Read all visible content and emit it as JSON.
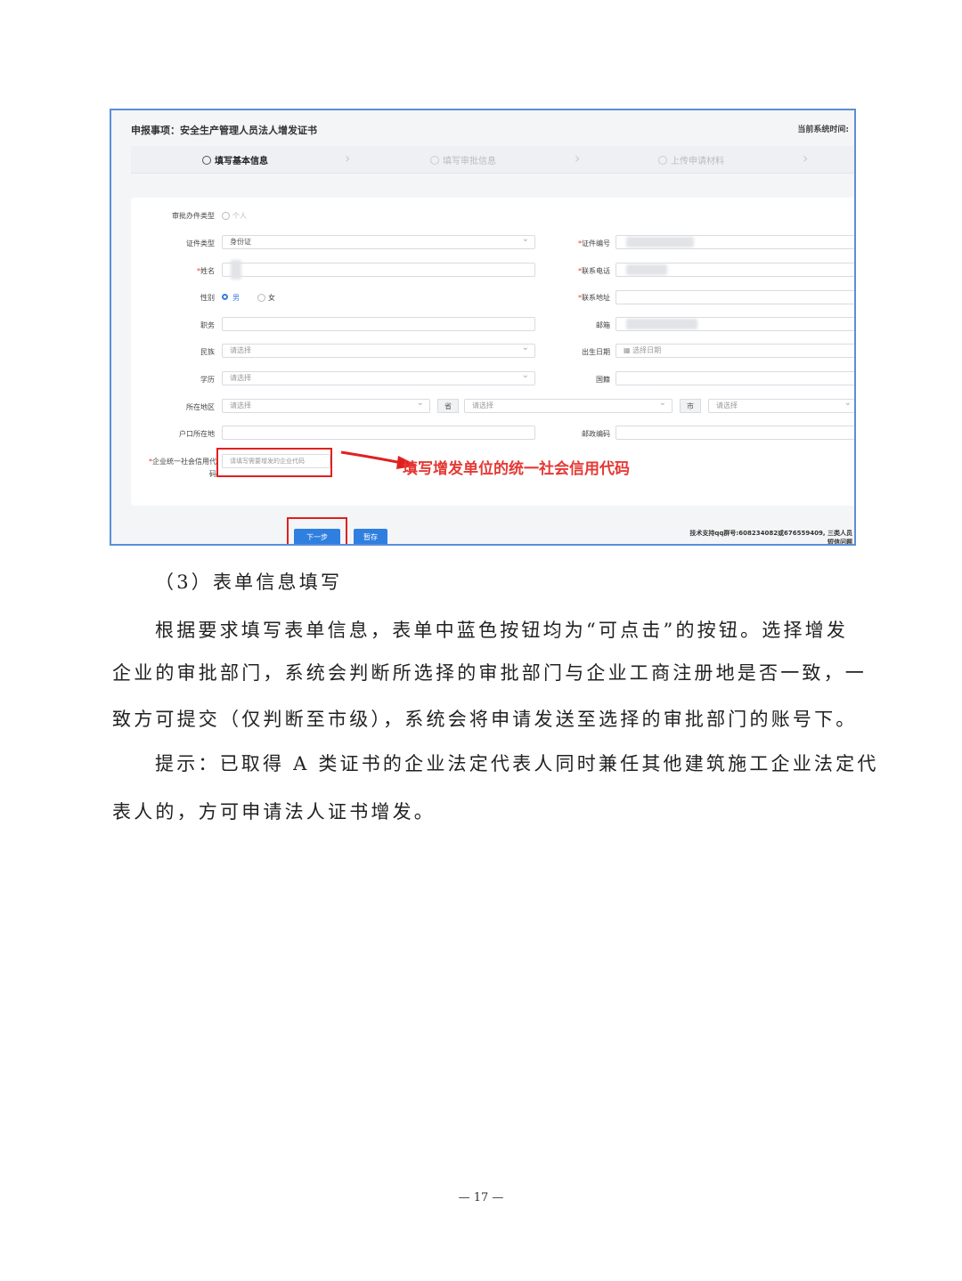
{
  "screenshot": {
    "title": "申报事项：安全生产管理人员法人增发证书",
    "system_time_label": "当前系统时间:",
    "steps": [
      {
        "label": "填写基本信息",
        "active": true
      },
      {
        "label": "填写审批信息",
        "active": false
      },
      {
        "label": "上传申请材料",
        "active": false
      }
    ],
    "form": {
      "approval_type_label": "审批办件类型",
      "approval_type_value": "个人",
      "id_type_label": "证件类型",
      "id_type_value": "身份证",
      "id_number_label": "证件编号",
      "name_label": "姓名",
      "phone_label": "联系电话",
      "gender_label": "性别",
      "gender_male": "男",
      "gender_female": "女",
      "address_label": "联系地址",
      "position_label": "职务",
      "email_label": "邮箱",
      "ethnicity_label": "民族",
      "ethnicity_placeholder": "请选择",
      "birthdate_label": "出生日期",
      "birthdate_placeholder": "选择日期",
      "education_label": "学历",
      "education_placeholder": "请选择",
      "nationality_label": "国籍",
      "region_label": "所在地区",
      "region_placeholder": "请选择",
      "province_btn": "省",
      "city_btn": "市",
      "household_label": "户口所在地",
      "postcode_label": "邮政编码",
      "credit_code_label_1": "企业统一社会信用代",
      "credit_code_label_2": "码",
      "credit_code_placeholder": "请填写需要增发的企业代码"
    },
    "annotation": "填写增发单位的统一社会信用代码",
    "next_button": "下一步",
    "save_button": "暂存",
    "support_text_1": "技术支持qq群号:608234082或676559409, 三类人员",
    "support_text_2": "短信问题"
  },
  "section_heading": "（3）表单信息填写",
  "paragraphs": [
    "根据要求填写表单信息，表单中蓝色按钮均为“可点击”的按钮。选择增发",
    "企业的审批部门，系统会判断所选择的审批部门与企业工商注册地是否一致，一",
    "致方可提交（仅判断至市级），系统会将申请发送至选择的审批部门的账号下。",
    "提示：已取得 A 类证书的企业法定代表人同时兼任其他建筑施工企业法定代",
    "表人的，方可申请法人证书增发。"
  ],
  "page_number": "— 17 —"
}
